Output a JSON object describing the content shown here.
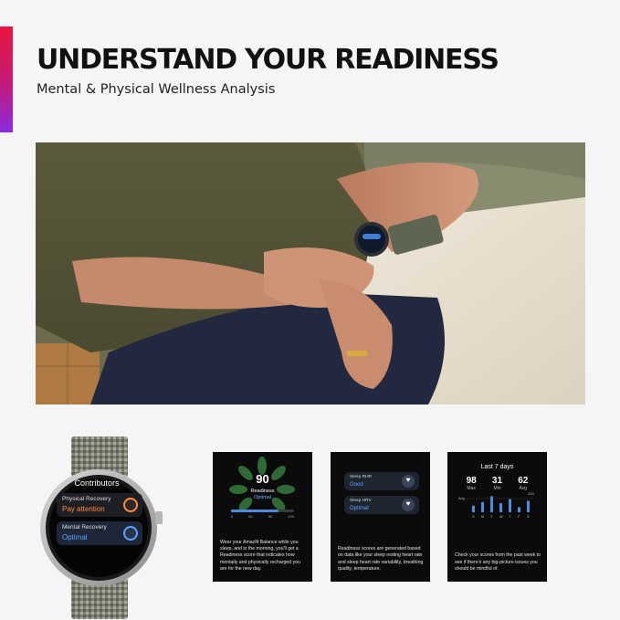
{
  "header": {
    "title": "UNDERSTAND YOUR READINESS",
    "subtitle": "Mental & Physical Wellness Analysis"
  },
  "colors": {
    "accent_top": "#e8163c",
    "accent_bottom": "#8a2be2",
    "screen_bg": "#0b0b0b",
    "highlight_blue": "#5aa2ff",
    "warning_orange": "#ff8a3d"
  },
  "watch_face": {
    "title": "Contributors",
    "items": [
      {
        "label": "Physical Recovery",
        "value": "Pay attention",
        "icon": "running-person-icon"
      },
      {
        "label": "Mental Recovery",
        "value": "Optimal",
        "icon": "brain-pin-icon"
      }
    ]
  },
  "screen1": {
    "score": "90",
    "label": "Readiness",
    "status": "Optimal",
    "scale_ticks": [
      "0",
      "60",
      "80",
      "100"
    ],
    "scale_fill_fraction": 0.75,
    "description": "Wear your Amazfit Balance while you sleep, and in the morning, you'll get a Readiness score that indicates how mentally and physically recharged you are for the new day."
  },
  "screen2": {
    "items": [
      {
        "label": "Sleep RHR",
        "value": "Good",
        "icon": "heart-icon"
      },
      {
        "label": "Sleep HRV",
        "value": "Optimal",
        "icon": "heart-pulse-icon"
      }
    ],
    "description": "Readiness scores are generated based on data like your sleep resting heart rate and sleep heart rate variability, breathing quality, temperature."
  },
  "screen3": {
    "title": "Last 7 days",
    "stats": [
      {
        "value": "98",
        "label": "Max"
      },
      {
        "value": "31",
        "label": "Min"
      },
      {
        "value": "62",
        "label": "Avg"
      }
    ],
    "axis_labels": [
      "Avg",
      "100"
    ],
    "days": [
      "S",
      "M",
      "T",
      "W",
      "T",
      "F",
      "S"
    ],
    "description": "Check your scores from the past week to see if there's any big-picture issues you should be mindful of."
  },
  "chart_data": {
    "type": "bar",
    "title": "Last 7 days",
    "categories": [
      "S",
      "M",
      "T",
      "W",
      "T",
      "F",
      "S"
    ],
    "values": [
      40,
      62,
      98,
      55,
      80,
      31,
      70
    ],
    "ylim": [
      0,
      100
    ],
    "xlabel": "",
    "ylabel": ""
  }
}
